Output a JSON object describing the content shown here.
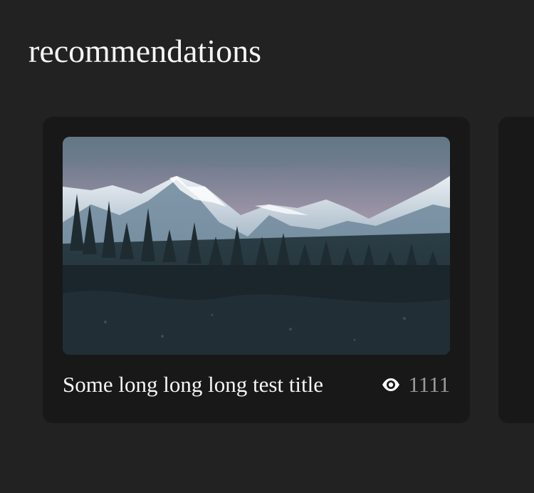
{
  "page": {
    "title": "recommendations"
  },
  "cards": [
    {
      "image": "mountain-forest-photo",
      "title": "Some long long long test title",
      "views": "1111",
      "views_icon": "eye-icon"
    }
  ],
  "colors": {
    "background": "#222222",
    "card_background": "#181818",
    "title_text": "#f5f5f5",
    "views_text": "#9a9a9a"
  }
}
